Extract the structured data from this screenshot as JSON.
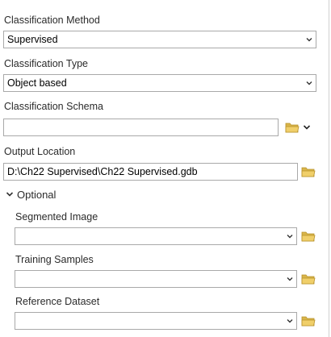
{
  "classification_method": {
    "label": "Classification Method",
    "value": "Supervised"
  },
  "classification_type": {
    "label": "Classification Type",
    "value": "Object based"
  },
  "classification_schema": {
    "label": "Classification Schema",
    "value": ""
  },
  "output_location": {
    "label": "Output Location",
    "value": "D:\\Ch22 Supervised\\Ch22 Supervised.gdb"
  },
  "optional": {
    "label": "Optional",
    "segmented_image": {
      "label": "Segmented Image",
      "value": ""
    },
    "training_samples": {
      "label": "Training Samples",
      "value": ""
    },
    "reference_dataset": {
      "label": "Reference Dataset",
      "value": ""
    }
  },
  "colors": {
    "folder": "#d9b54a",
    "border": "#a9a9a9",
    "text": "#2b2b2b"
  },
  "icons": [
    "chevron-down-icon",
    "folder-icon",
    "expand-triangle-icon"
  ]
}
